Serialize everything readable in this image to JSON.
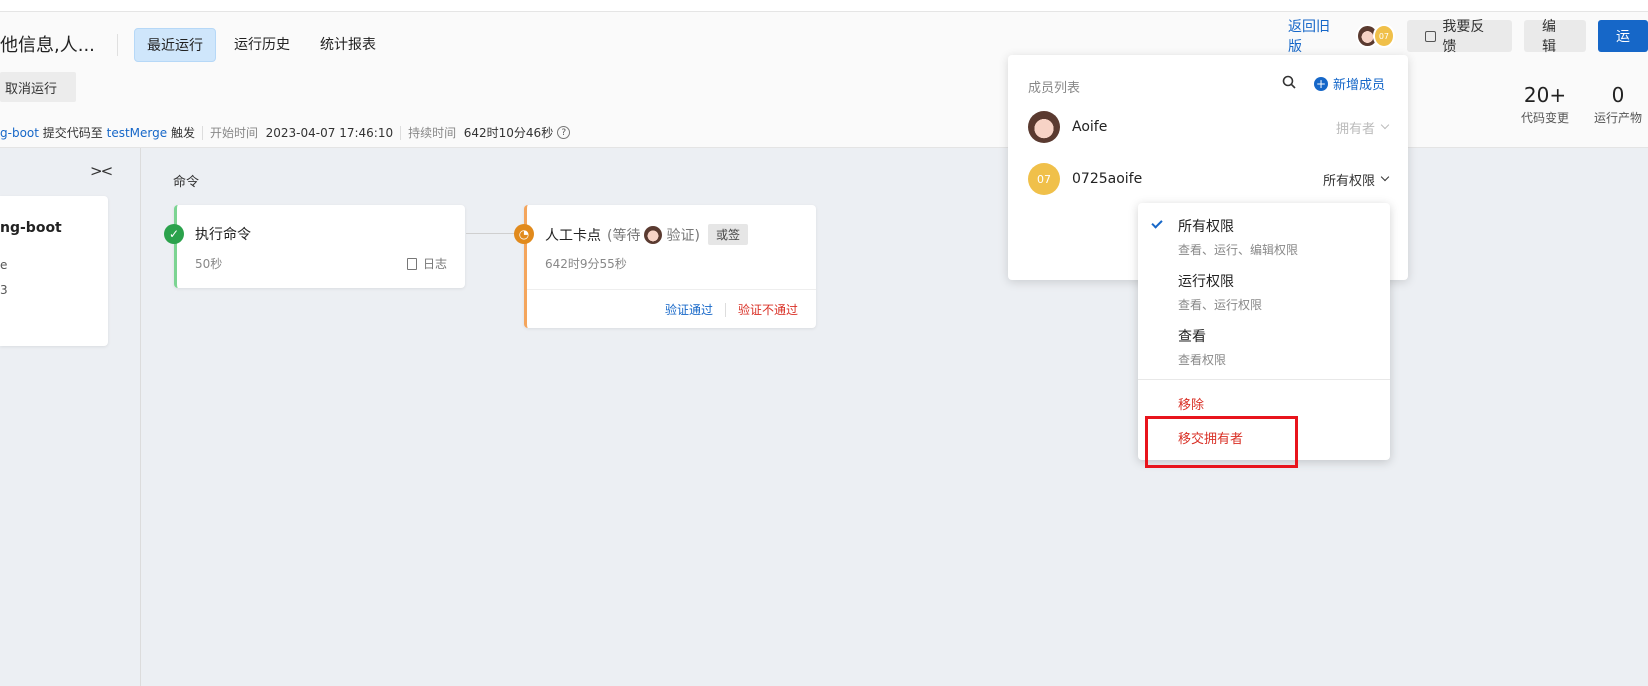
{
  "header": {
    "title": "他信息,人...",
    "tabs": [
      {
        "label": "最近运行",
        "active": true
      },
      {
        "label": "运行历史",
        "active": false
      },
      {
        "label": "统计报表",
        "active": false
      }
    ],
    "cancel_label": "取消运行",
    "info": {
      "repo": "g-boot",
      "action": "提交代码至",
      "branch": "testMerge",
      "trigger": "触发",
      "start_label": "开始时间",
      "start_value": "2023-04-07 17:46:10",
      "duration_label": "持续时间",
      "duration_value": "642时10分46秒",
      "help_icon": "?"
    },
    "back_old_label": "返回旧版",
    "avatar_07": "07",
    "feedback_label": "我要反馈",
    "edit_label": "编辑",
    "run_label": "运",
    "stats": [
      {
        "num": "20+",
        "label": "代码变更"
      },
      {
        "num": "0",
        "label": "运行产物"
      }
    ]
  },
  "left": {
    "collapse_glyph": "><",
    "card_title": "ng-boot",
    "line1": "e",
    "line2": "3"
  },
  "stage": {
    "label": "命令",
    "card1": {
      "title": "执行命令",
      "sub": "50秒",
      "log_label": "日志",
      "status_glyph": "✓"
    },
    "card2": {
      "title": "人工卡点",
      "waiting_prefix": "(等待",
      "waiting_suffix": "验证)",
      "tag": "或签",
      "sub": "642时9分55秒",
      "status_glyph": "◔",
      "pass_label": "验证通过",
      "fail_label": "验证不通过"
    }
  },
  "members": {
    "title": "成员列表",
    "add_label": "新增成员",
    "plus_glyph": "+",
    "rows": [
      {
        "name": "Aoife",
        "role": "拥有者"
      },
      {
        "name": "0725aoife",
        "role": "所有权限",
        "avatar": "07"
      }
    ]
  },
  "perm_menu": {
    "options": [
      {
        "title": "所有权限",
        "desc": "查看、运行、编辑权限",
        "checked": true
      },
      {
        "title": "运行权限",
        "desc": "查看、运行权限",
        "checked": false
      },
      {
        "title": "查看",
        "desc": "查看权限",
        "checked": false
      }
    ],
    "remove_label": "移除",
    "transfer_label": "移交拥有者"
  },
  "colors": {
    "accent": "#1667c8",
    "success": "#2ba24c",
    "warning": "#e18a1c",
    "danger": "#d93026",
    "highlight": "#e8141c"
  }
}
